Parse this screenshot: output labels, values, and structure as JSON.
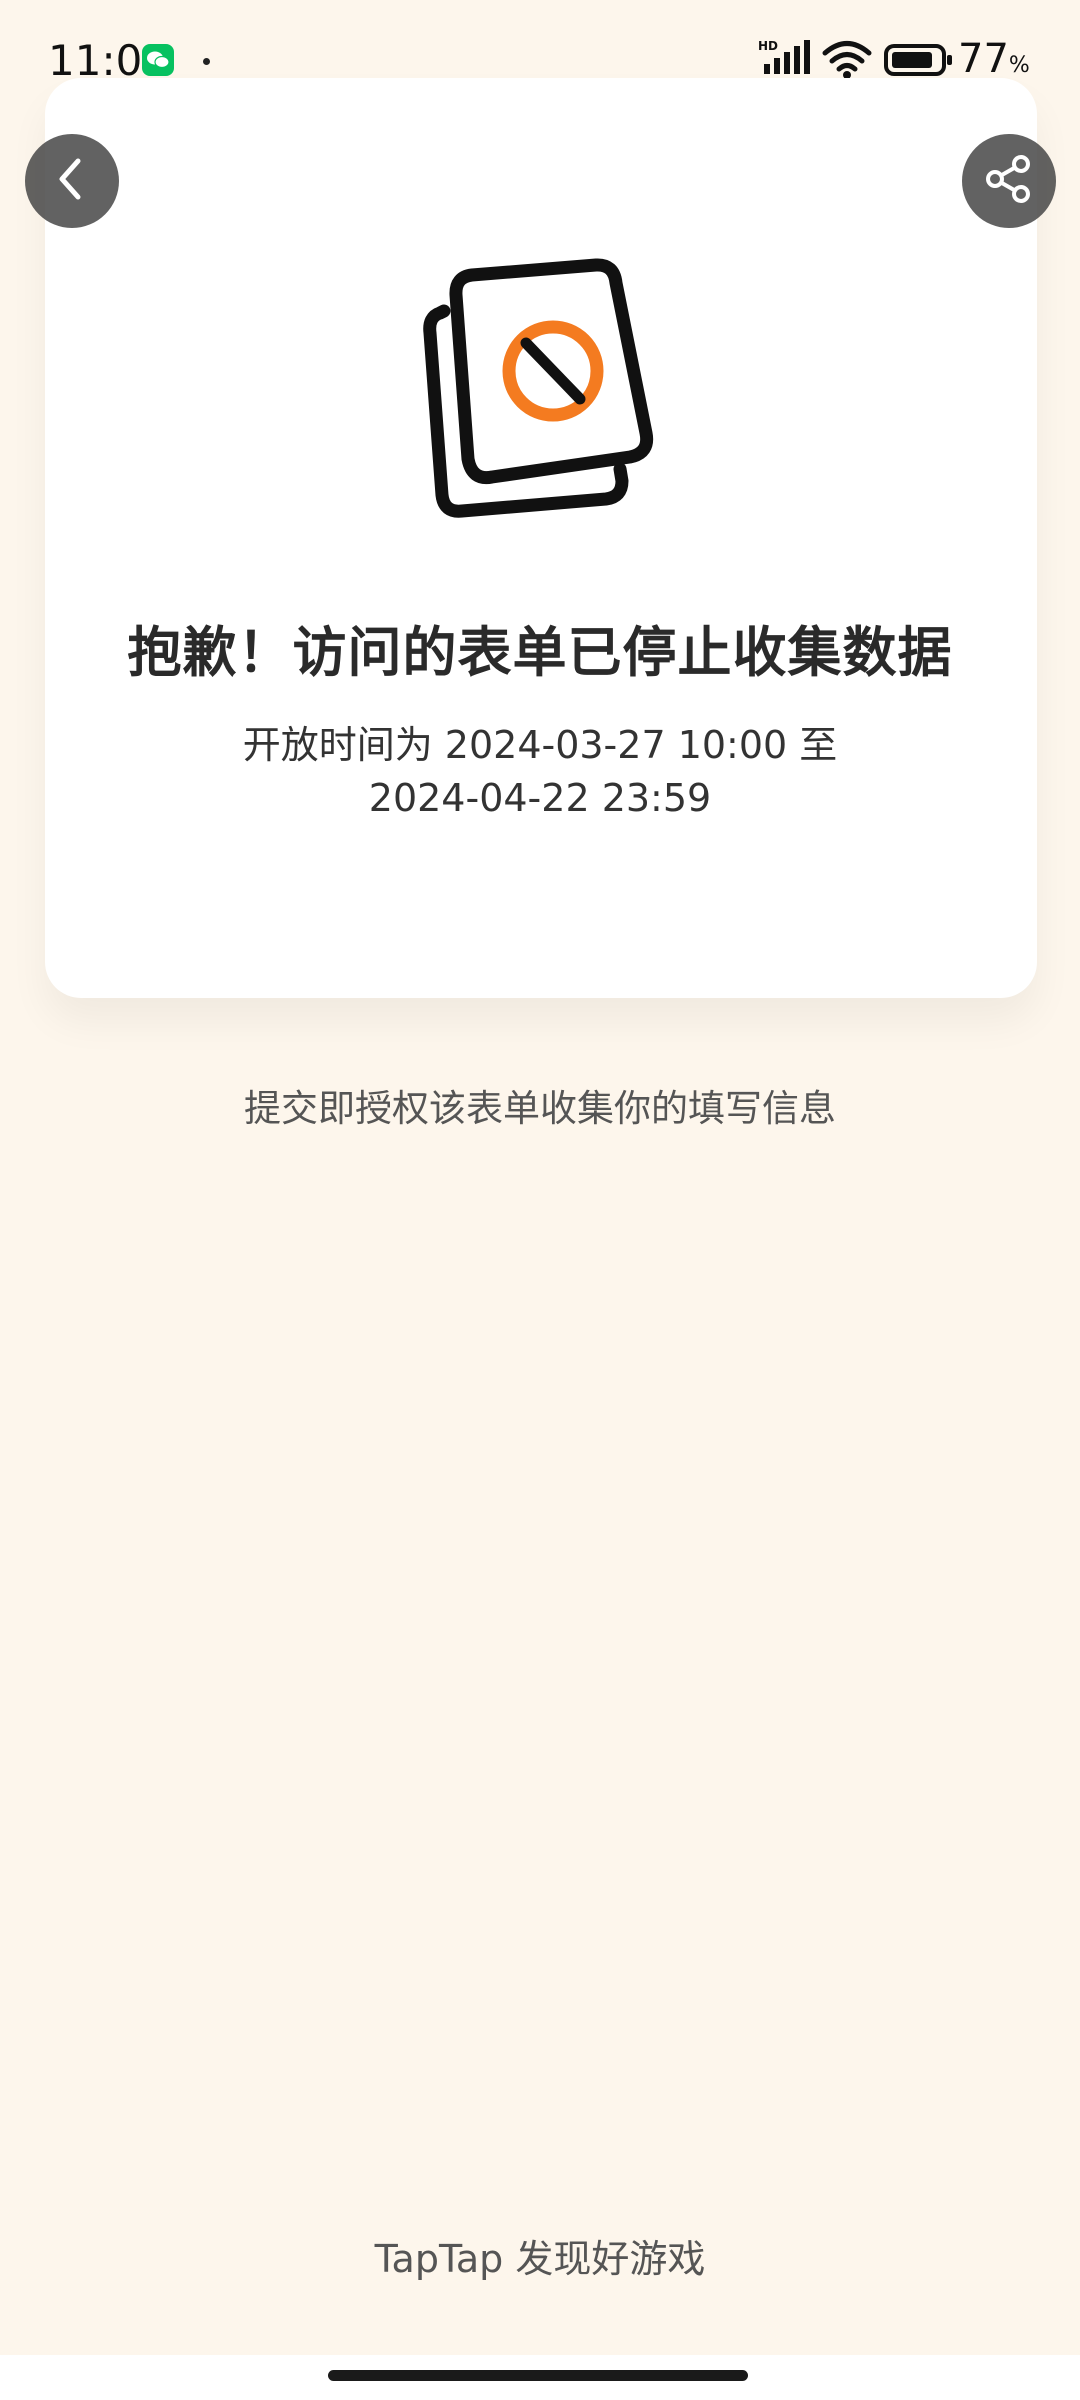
{
  "status_bar": {
    "time": "11:01",
    "battery_value": "77",
    "battery_unit": "%",
    "network_label": "HD",
    "icons": [
      "wechat-icon",
      "signal-icon",
      "wifi-icon",
      "battery-icon"
    ]
  },
  "toolbar": {
    "back_icon": "chevron-left-icon",
    "share_icon": "share-icon"
  },
  "card": {
    "illustration": "form-closed-icon",
    "title": "抱歉！访问的表单已停止收集数据",
    "subtitle_line1": "开放时间为 2024-03-27 10:00 至",
    "subtitle_line2": "2024-04-22 23:59"
  },
  "consent": "提交即授权该表单收集你的填写信息",
  "footer": {
    "brand": "TapTap 发现好游戏"
  },
  "colors": {
    "page_background": "#FDF6EC",
    "card_background": "#FFFFFF",
    "accent_orange": "#F47B20",
    "button_overlay": "#464646"
  }
}
